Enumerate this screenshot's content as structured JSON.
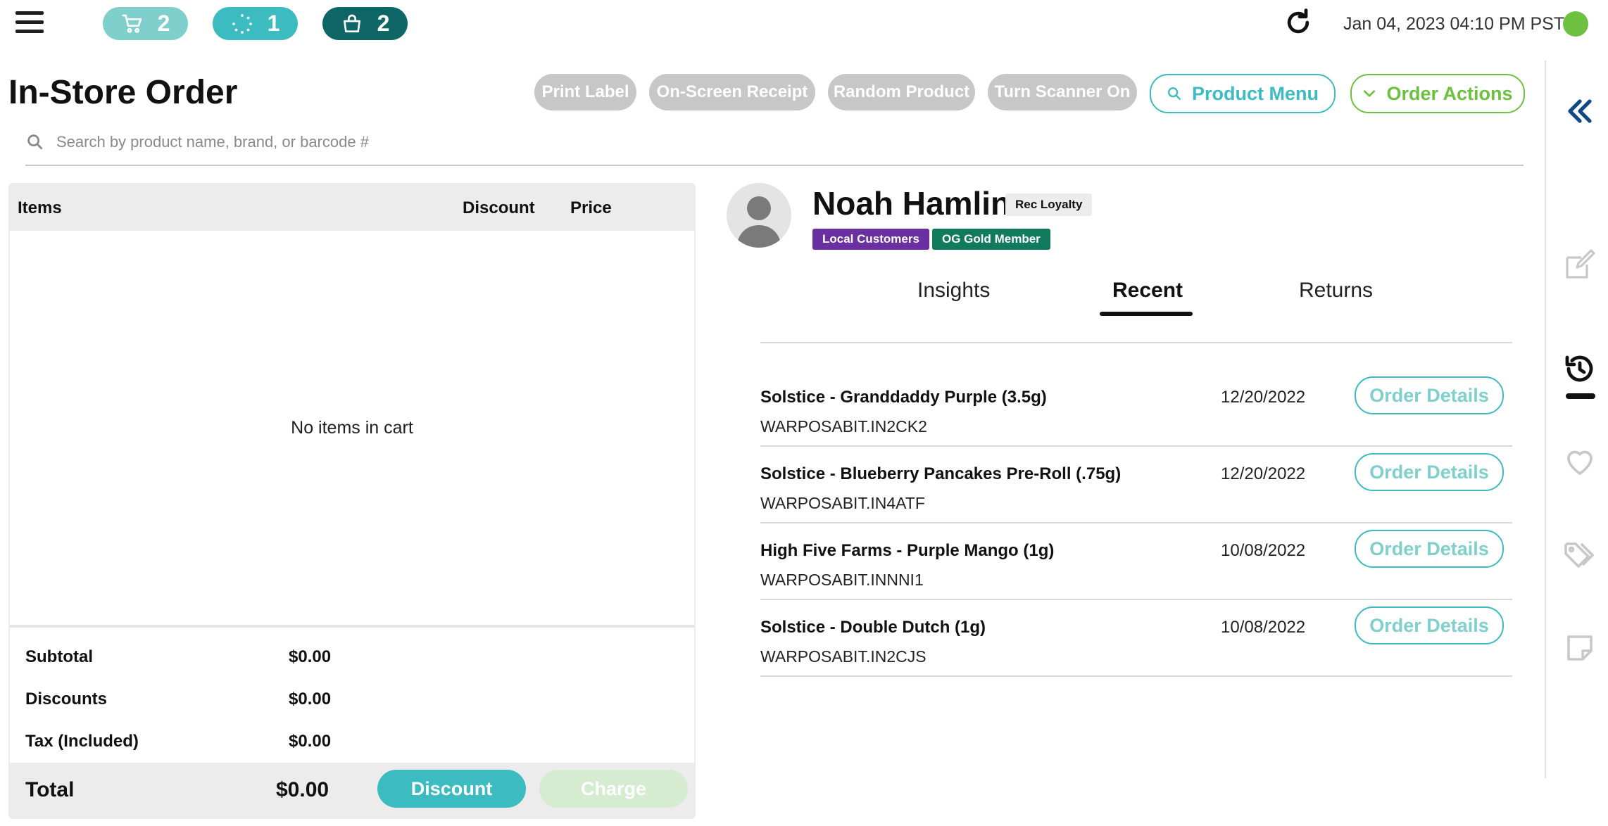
{
  "topbar": {
    "pills": [
      {
        "icon": "cart-icon",
        "count": "2"
      },
      {
        "icon": "loading-icon",
        "count": "1"
      },
      {
        "icon": "basket-icon",
        "count": "2"
      }
    ],
    "datetime": "Jan 04, 2023 04:10 PM PST",
    "status_color": "#6dc040"
  },
  "page": {
    "title": "In-Store Order"
  },
  "actions": {
    "print_label": "Print Label",
    "on_screen_receipt": "On-Screen Receipt",
    "random_product": "Random Product",
    "turn_scanner_on": "Turn Scanner On",
    "product_menu": "Product Menu",
    "order_actions": "Order Actions"
  },
  "search": {
    "placeholder": "Search by product name, brand, or barcode #"
  },
  "cart": {
    "headers": {
      "items": "Items",
      "discount": "Discount",
      "price": "Price"
    },
    "empty_message": "No items in cart",
    "subtotal_label": "Subtotal",
    "subtotal": "$0.00",
    "discounts_label": "Discounts",
    "discounts": "$0.00",
    "tax_label": "Tax (Included)",
    "tax": "$0.00",
    "total_label": "Total",
    "total": "$0.00",
    "discount_button": "Discount",
    "charge_button": "Charge"
  },
  "customer": {
    "name": "Noah Hamlin",
    "loyalty": "Rec Loyalty",
    "tags": [
      "Local Customers",
      "OG Gold Member"
    ],
    "tabs": [
      "Insights",
      "Recent",
      "Returns"
    ],
    "active_tab": "Recent",
    "orders": [
      {
        "name": "Solstice - Granddaddy Purple (3.5g)",
        "code": "WARPOSABIT.IN2CK2",
        "date": "12/20/2022",
        "button": "Order Details"
      },
      {
        "name": "Solstice - Blueberry Pancakes Pre-Roll (.75g)",
        "code": "WARPOSABIT.IN4ATF",
        "date": "12/20/2022",
        "button": "Order Details"
      },
      {
        "name": "High Five Farms - Purple Mango (1g)",
        "code": "WARPOSABIT.INNNI1",
        "date": "10/08/2022",
        "button": "Order Details"
      },
      {
        "name": "Solstice - Double Dutch (1g)",
        "code": "WARPOSABIT.IN2CJS",
        "date": "10/08/2022",
        "button": "Order Details"
      }
    ]
  },
  "rail": {
    "icons": [
      "collapse-icon",
      "edit-icon",
      "history-icon",
      "heart-icon",
      "tag-icon",
      "note-icon"
    ],
    "active": "history-icon"
  },
  "colors": {
    "teal": "#3cbcc0",
    "light_teal": "#7fcfcc",
    "dark_teal": "#0f6667",
    "green": "#6dc040",
    "disabled_gray": "#c7c7c7",
    "purple_tag": "#6a2fa0",
    "green_tag": "#127a5c"
  }
}
